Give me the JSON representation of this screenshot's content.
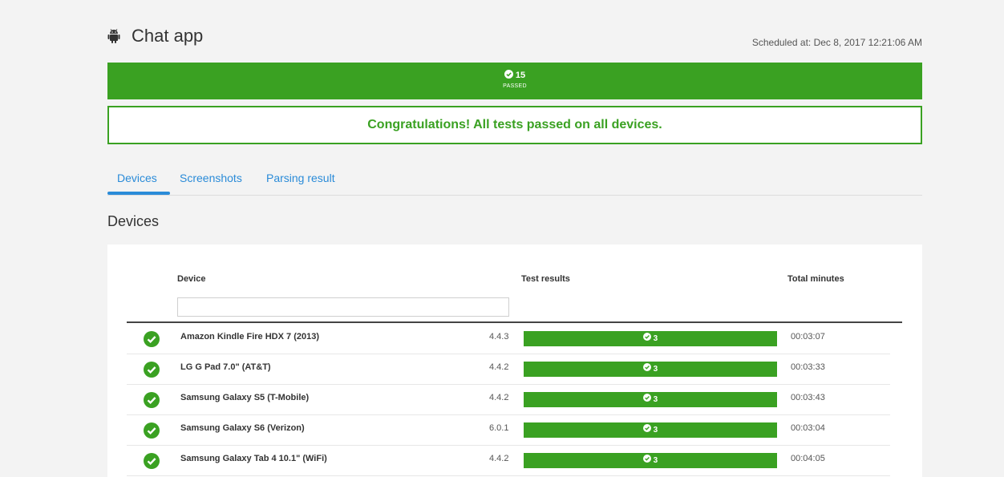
{
  "header": {
    "app_title": "Chat app",
    "scheduled": "Scheduled at: Dec 8, 2017 12:21:06 AM"
  },
  "summary": {
    "count": "15",
    "label": "PASSED"
  },
  "congrats": "Congratulations! All tests passed on all devices.",
  "tabs": [
    {
      "label": "Devices",
      "active": true
    },
    {
      "label": "Screenshots",
      "active": false
    },
    {
      "label": "Parsing result",
      "active": false
    }
  ],
  "section_title": "Devices",
  "table": {
    "columns": {
      "device": "Device",
      "test_results": "Test results",
      "total_minutes": "Total minutes"
    },
    "filter_placeholder": "",
    "rows": [
      {
        "device": "Amazon Kindle Fire HDX 7 (2013)",
        "version": "4.4.3",
        "passed": "3",
        "minutes": "00:03:07"
      },
      {
        "device": "LG G Pad 7.0\" (AT&T)",
        "version": "4.4.2",
        "passed": "3",
        "minutes": "00:03:33"
      },
      {
        "device": "Samsung Galaxy S5 (T-Mobile)",
        "version": "4.4.2",
        "passed": "3",
        "minutes": "00:03:43"
      },
      {
        "device": "Samsung Galaxy S6 (Verizon)",
        "version": "6.0.1",
        "passed": "3",
        "minutes": "00:03:04"
      },
      {
        "device": "Samsung Galaxy Tab 4 10.1\" (WiFi)",
        "version": "4.4.2",
        "passed": "3",
        "minutes": "00:04:05"
      }
    ]
  },
  "colors": {
    "success": "#3aa122",
    "link": "#2a8bd8"
  },
  "icons": {
    "app": "android-icon",
    "pass": "check-circle-icon"
  }
}
